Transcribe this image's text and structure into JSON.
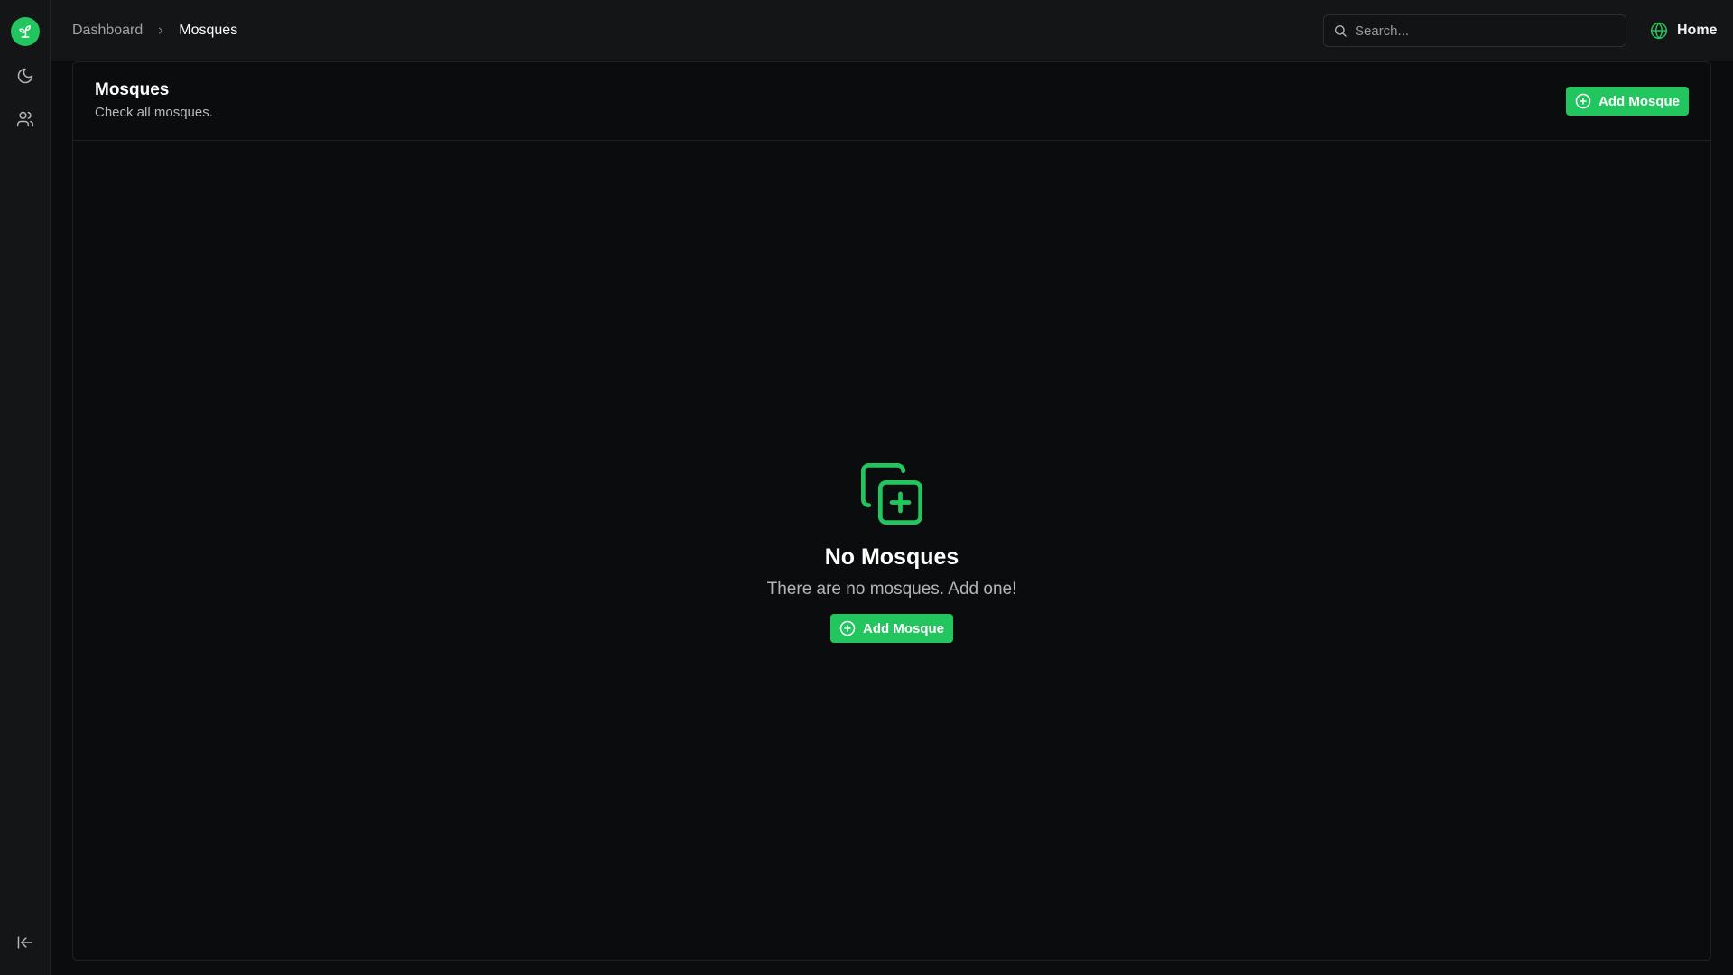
{
  "header": {
    "breadcrumb": {
      "parent": "Dashboard",
      "current": "Mosques"
    },
    "search_placeholder": "Search...",
    "home_label": "Home"
  },
  "page": {
    "title": "Mosques",
    "subtitle": "Check all mosques.",
    "add_button_label": "Add Mosque"
  },
  "empty_state": {
    "title": "No Mosques",
    "description": "There are no mosques. Add one!",
    "button_label": "Add Mosque"
  },
  "sidebar": {
    "items": [
      {
        "icon": "moon-icon"
      },
      {
        "icon": "users-icon"
      }
    ],
    "bottom_icon": "collapse-sidebar-icon"
  },
  "colors": {
    "accent": "#22c55e",
    "background": "#0b0c0e",
    "panel": "#141517",
    "avatar": "#6366f1"
  }
}
